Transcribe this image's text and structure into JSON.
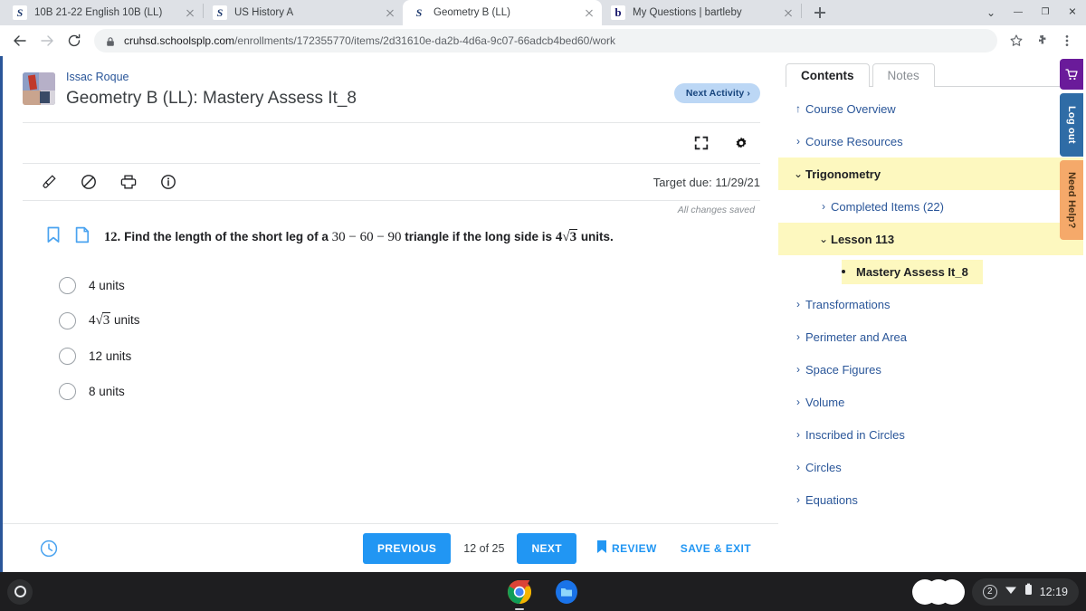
{
  "browser": {
    "tabs": [
      {
        "title": "10B 21-22 English 10B (LL)",
        "favicon": "schoology-icon",
        "active": false
      },
      {
        "title": "US History A",
        "favicon": "schoology-icon",
        "active": false
      },
      {
        "title": "Geometry B (LL)",
        "favicon": "schoology-icon",
        "active": true
      },
      {
        "title": "My Questions | bartleby",
        "favicon": "bartleby-icon",
        "active": false
      }
    ],
    "new_tab_label": "+",
    "window_controls": {
      "expand": "⌄",
      "minimize": "—",
      "maximize": "❐",
      "close": "✕"
    },
    "url_domain": "cruhsd.schoolsplp.com",
    "url_path": "/enrollments/172355770/items/2d31610e-da2b-4d6a-9c07-66adcb4bed60/work",
    "lock_icon": "lock-icon",
    "back_icon": "back-arrow-icon",
    "forward_icon": "forward-arrow-icon",
    "reload_icon": "reload-icon",
    "star_icon": "bookmark-star-icon",
    "extensions_icon": "puzzle-piece-icon",
    "menu_icon": "three-dot-menu-icon"
  },
  "activity": {
    "user_name": "Issac Roque",
    "title": "Geometry B (LL): Mastery Assess It_8",
    "next_activity_label": "Next Activity ›",
    "target_due": "Target due: 11/29/21",
    "saved_status": "All changes saved",
    "tools": [
      {
        "name": "highlighter-icon"
      },
      {
        "name": "clear-highlight-icon"
      },
      {
        "name": "print-icon"
      },
      {
        "name": "info-icon"
      }
    ],
    "view_tools": [
      {
        "name": "fullscreen-icon"
      },
      {
        "name": "settings-gear-icon"
      }
    ]
  },
  "question": {
    "number": "12.",
    "bookmark_icon": "bookmark-outline-icon",
    "note_icon": "note-page-icon",
    "text_parts": [
      {
        "type": "bold",
        "text": "Find the length of the short leg of a "
      },
      {
        "type": "math",
        "text": "30 − 60 − 90"
      },
      {
        "type": "bold",
        "text": " triangle if the long side is "
      },
      {
        "type": "sqrt",
        "coef": "4",
        "radicand": "3"
      },
      {
        "type": "bold",
        "text": " units."
      }
    ],
    "full_text": "12. Find the length of the short leg of a 30 − 60 − 90 triangle if the long side is 4√3 units.",
    "options": [
      {
        "label": "4 units",
        "selected": false,
        "has_sqrt": false
      },
      {
        "label": "4√3 units",
        "selected": false,
        "has_sqrt": true,
        "coef": "4",
        "radicand": "3",
        "suffix": " units"
      },
      {
        "label": "12 units",
        "selected": false,
        "has_sqrt": false
      },
      {
        "label": "8 units",
        "selected": false,
        "has_sqrt": false
      }
    ]
  },
  "bottom_nav": {
    "clock_icon": "clock-icon",
    "previous_label": "PREVIOUS",
    "page_counter": "12 of 25",
    "next_label": "NEXT",
    "review_label": "REVIEW",
    "review_icon": "bookmark-filled-icon",
    "save_exit_label": "SAVE & EXIT"
  },
  "sidebar": {
    "tabs": [
      {
        "label": "Contents",
        "active": true
      },
      {
        "label": "Notes",
        "active": false
      }
    ],
    "items": [
      {
        "label": "Course Overview",
        "level": 0,
        "marker": "up-arrow",
        "highlighted": false
      },
      {
        "label": "Course Resources",
        "level": 0,
        "marker": "chevron-right",
        "highlighted": false
      },
      {
        "label": "Trigonometry",
        "level": 0,
        "marker": "chevron-down",
        "highlighted": true
      },
      {
        "label": "Completed Items (22)",
        "level": 1,
        "marker": "chevron-right",
        "highlighted": false
      },
      {
        "label": "Lesson 113",
        "level": 1,
        "marker": "chevron-down",
        "highlighted": true
      },
      {
        "label": "Mastery Assess It_8",
        "level": 2,
        "marker": "bullet",
        "highlighted": true
      },
      {
        "label": "Transformations",
        "level": 0,
        "marker": "chevron-right",
        "highlighted": false
      },
      {
        "label": "Perimeter and Area",
        "level": 0,
        "marker": "chevron-right",
        "highlighted": false
      },
      {
        "label": "Space Figures",
        "level": 0,
        "marker": "chevron-right",
        "highlighted": false
      },
      {
        "label": "Volume",
        "level": 0,
        "marker": "chevron-right",
        "highlighted": false
      },
      {
        "label": "Inscribed in Circles",
        "level": 0,
        "marker": "chevron-right",
        "highlighted": false
      },
      {
        "label": "Circles",
        "level": 0,
        "marker": "chevron-right",
        "highlighted": false
      },
      {
        "label": "Equations",
        "level": 0,
        "marker": "chevron-right",
        "highlighted": false
      }
    ]
  },
  "edge_buttons": [
    {
      "name": "cart-icon",
      "label": "",
      "color": "#6a1b9a"
    },
    {
      "name": "logout-tab",
      "label": "Log out",
      "color": "#2f6ca6"
    },
    {
      "name": "need-help-tab",
      "label": "Need Help?",
      "color": "#f5a96a"
    }
  ],
  "shelf": {
    "launcher_icon": "launcher-icon",
    "apps": [
      {
        "name": "chrome-icon"
      },
      {
        "name": "files-icon"
      }
    ],
    "tray": {
      "notification_count": "2",
      "wifi_icon": "wifi-icon",
      "battery_icon": "battery-icon",
      "time": "12:19"
    }
  },
  "colors": {
    "accent_blue": "#2196f3",
    "link_blue": "#2a5699",
    "highlight_yellow": "#fdf8bf",
    "next_activity_bg": "#bcd7f5",
    "page_border": "#2a5699"
  }
}
